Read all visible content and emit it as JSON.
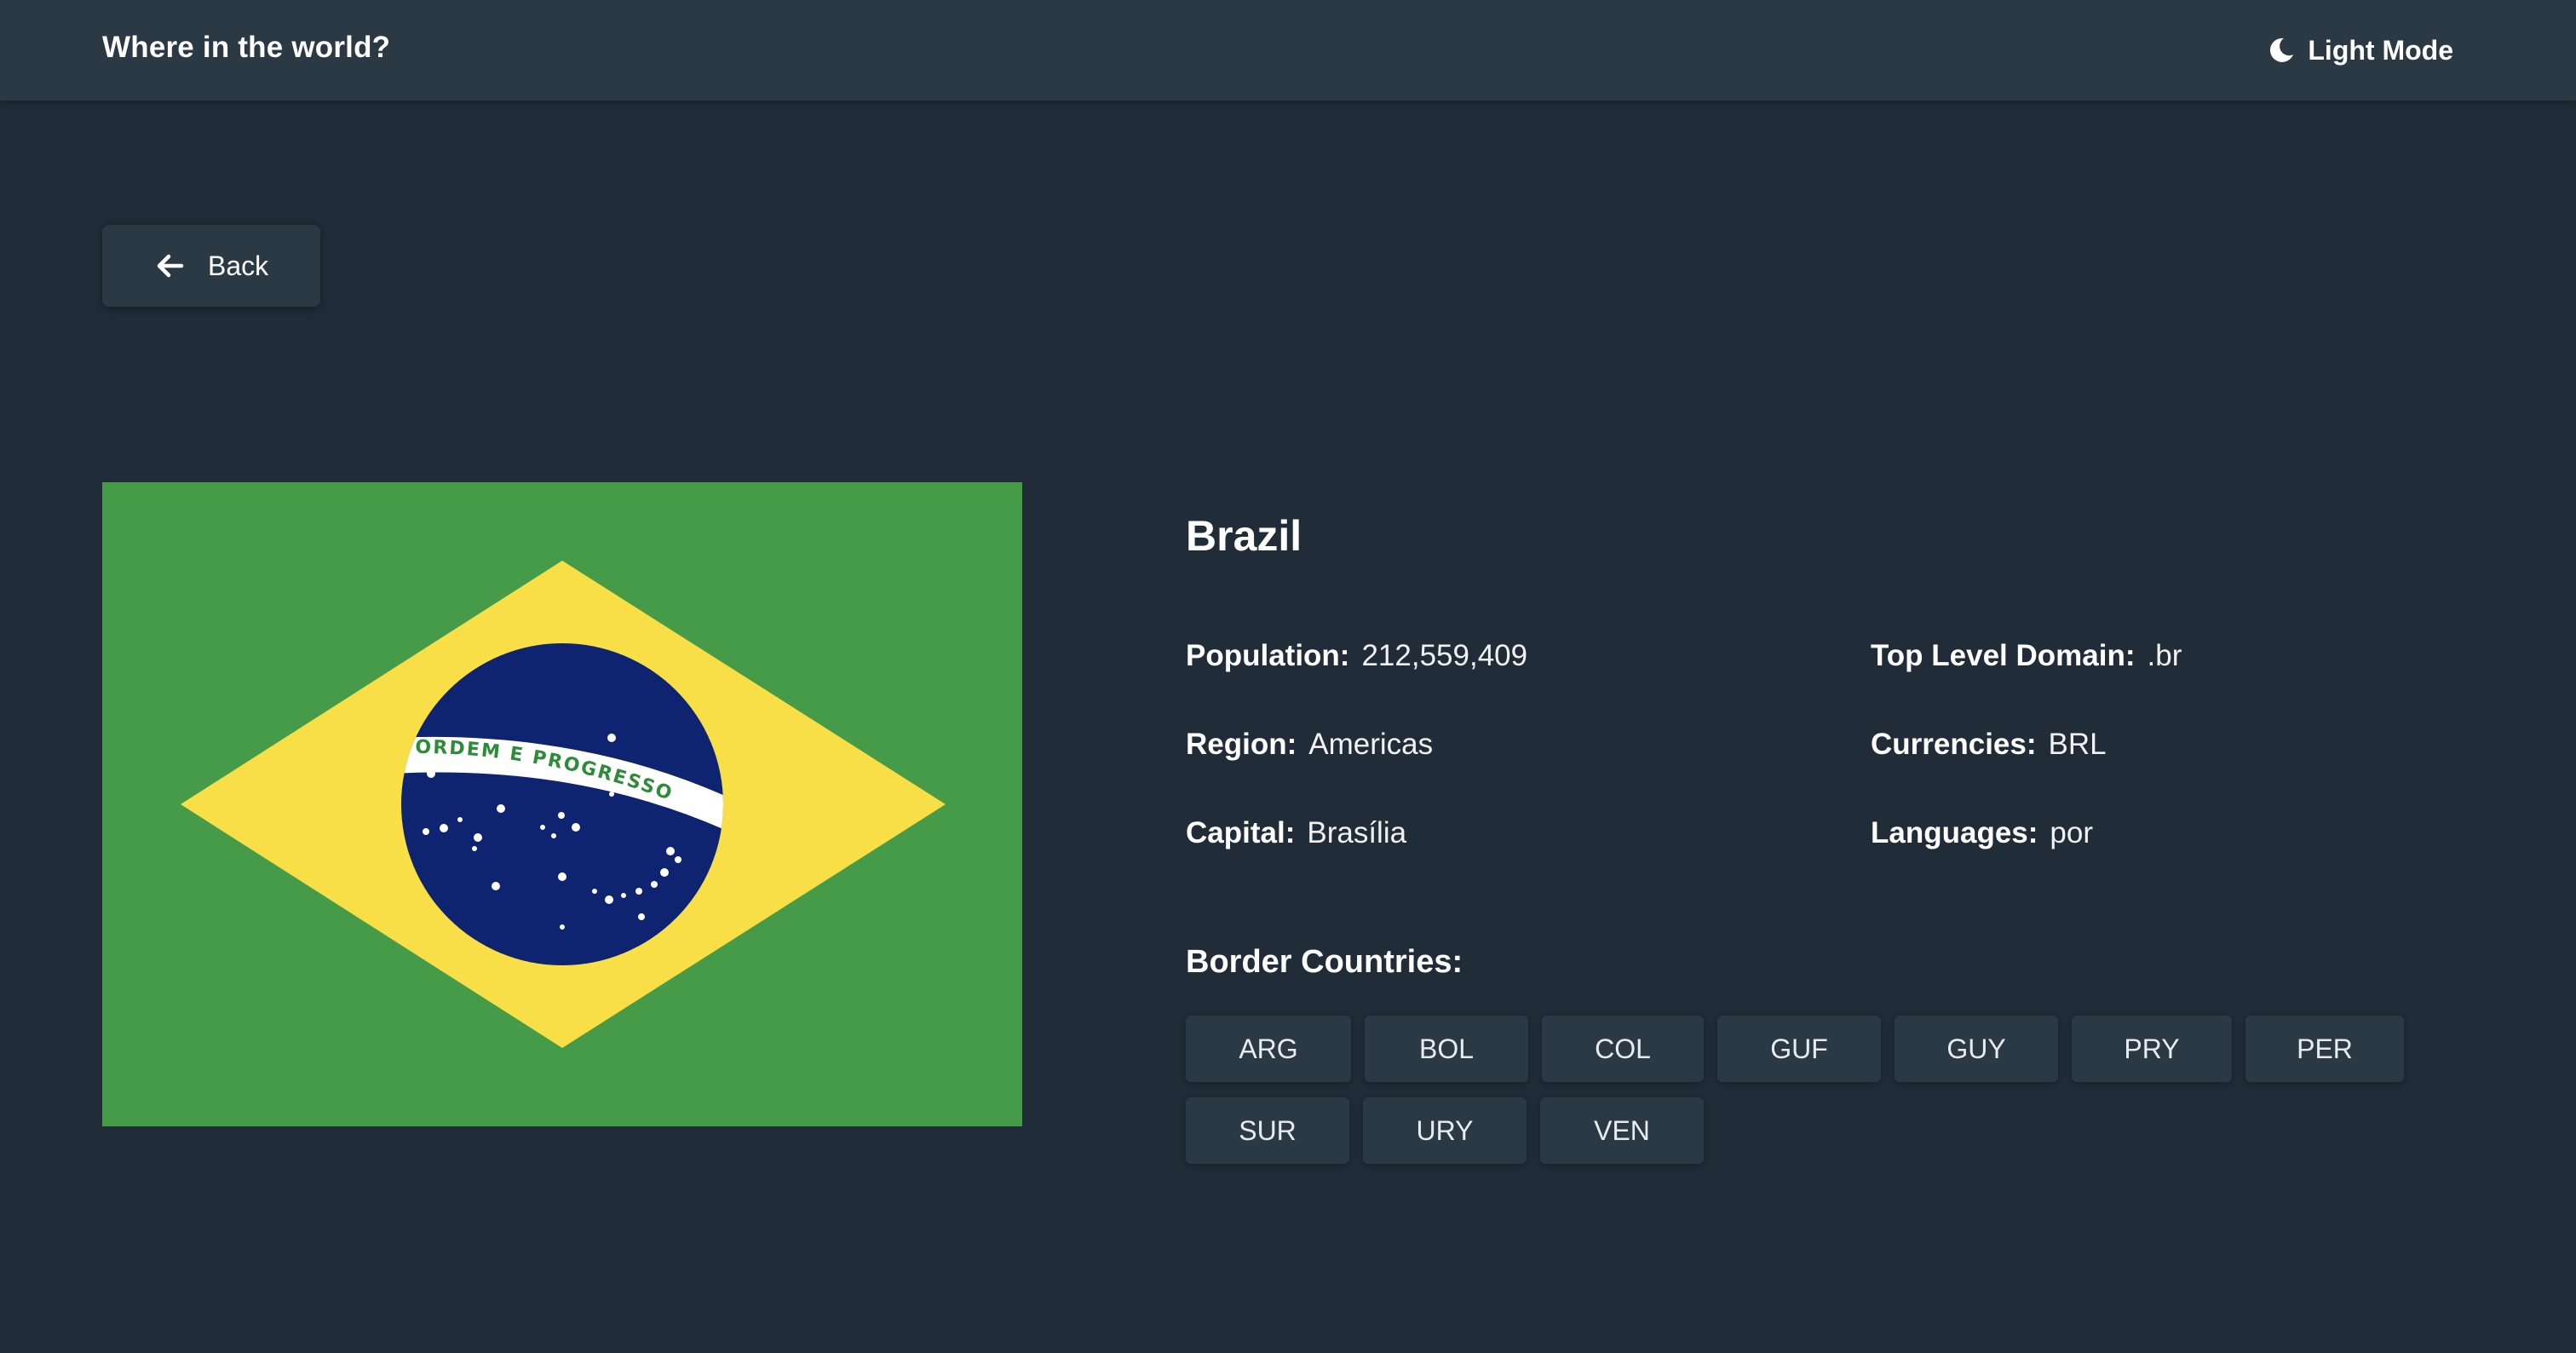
{
  "header": {
    "title": "Where in the world?",
    "theme_toggle_label": "Light Mode",
    "theme_icon": "moon-icon"
  },
  "back_button": {
    "label": "Back",
    "icon": "arrow-left-icon"
  },
  "country": {
    "name": "Brazil",
    "flag_motto": "ORDEM E PROGRESSO",
    "details": {
      "population_label": "Population:",
      "population": "212,559,409",
      "region_label": "Region:",
      "region": "Americas",
      "capital_label": "Capital:",
      "capital": "Brasília",
      "tld_label": "Top Level Domain:",
      "tld": ".br",
      "currencies_label": "Currencies:",
      "currencies": "BRL",
      "languages_label": "Languages:",
      "languages": "por"
    },
    "border_title": "Border Countries:",
    "borders": [
      "ARG",
      "BOL",
      "COL",
      "GUF",
      "GUY",
      "PRY",
      "PER",
      "SUR",
      "URY",
      "VEN"
    ]
  },
  "colors": {
    "background": "#202c37",
    "elements": "#2b3945",
    "text": "#ffffff",
    "flag_green": "#459b48",
    "flag_yellow": "#f8de47",
    "flag_blue": "#0e2470",
    "flag_band": "#ffffff",
    "flag_motto_text": "#2e8b3a"
  }
}
